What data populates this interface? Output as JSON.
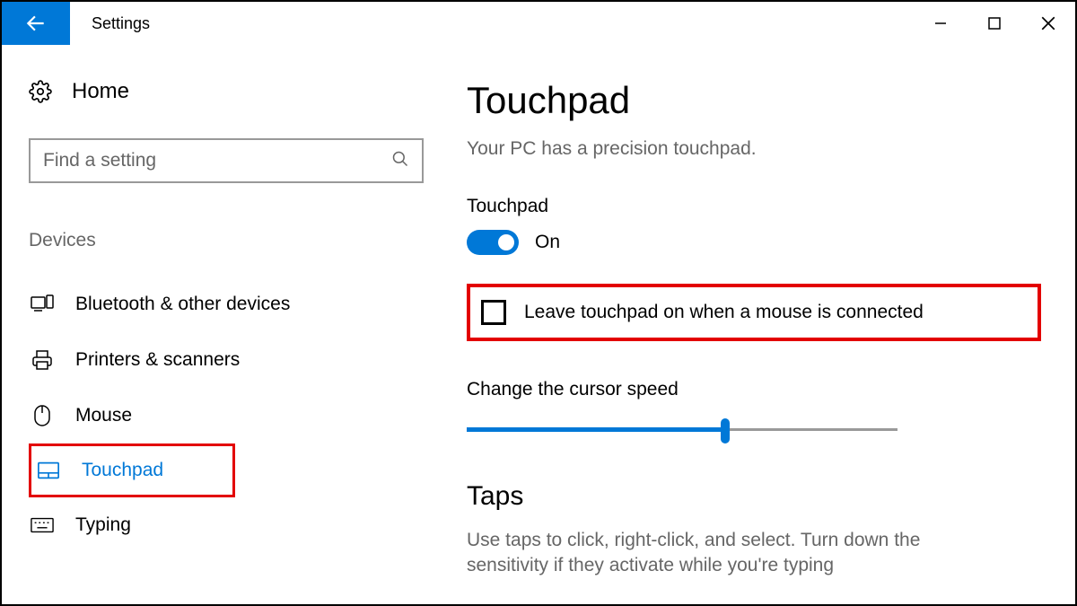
{
  "titlebar": {
    "title": "Settings"
  },
  "sidebar": {
    "home": "Home",
    "search_placeholder": "Find a setting",
    "category": "Devices",
    "items": [
      {
        "label": "Bluetooth & other devices"
      },
      {
        "label": "Printers & scanners"
      },
      {
        "label": "Mouse"
      },
      {
        "label": "Touchpad"
      },
      {
        "label": "Typing"
      }
    ]
  },
  "main": {
    "heading": "Touchpad",
    "description": "Your PC has a precision touchpad.",
    "toggle_section_label": "Touchpad",
    "toggle_state_label": "On",
    "checkbox_label": "Leave touchpad on when a mouse is connected",
    "slider_label": "Change the cursor speed",
    "taps_heading": "Taps",
    "taps_desc": "Use taps to click, right-click, and select. Turn down the sensitivity if they activate while you're typing"
  }
}
